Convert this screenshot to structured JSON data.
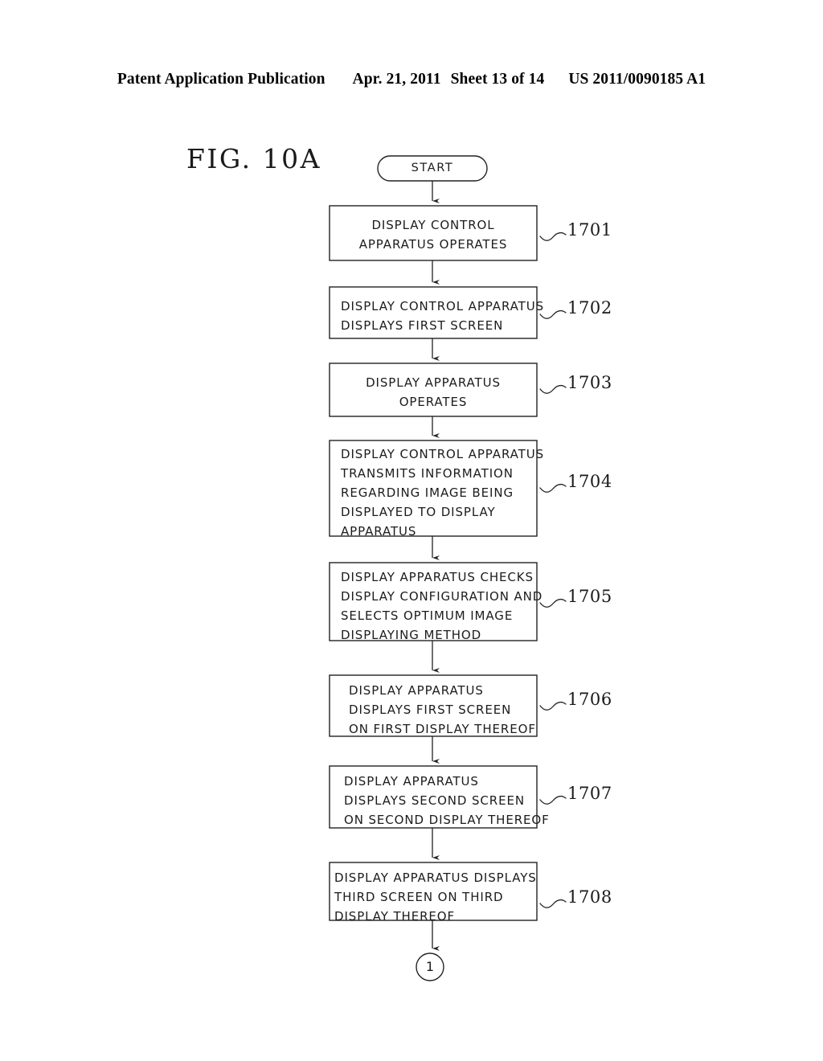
{
  "header": {
    "left": "Patent Application Publication",
    "date": "Apr. 21, 2011",
    "sheet": "Sheet 13 of 14",
    "pubnum": "US 2011/0090185 A1"
  },
  "figure": {
    "title": "FIG. 10A",
    "start_label": "START",
    "end_connector_label": "1"
  },
  "steps": [
    {
      "ref": "1701",
      "align": "center",
      "lines": [
        "DISPLAY CONTROL",
        "APPARATUS OPERATES"
      ],
      "text": "DISPLAY CONTROL\nAPPARATUS OPERATES"
    },
    {
      "ref": "1702",
      "align": "left",
      "lines": [
        "DISPLAY CONTROL APPARATUS",
        "DISPLAYS FIRST SCREEN"
      ],
      "text": "DISPLAY CONTROL APPARATUS\nDISPLAYS FIRST SCREEN"
    },
    {
      "ref": "1703",
      "align": "center",
      "lines": [
        "DISPLAY APPARATUS",
        "OPERATES"
      ],
      "text": "DISPLAY APPARATUS\nOPERATES"
    },
    {
      "ref": "1704",
      "align": "left",
      "lines": [
        "DISPLAY CONTROL APPARATUS",
        "TRANSMITS INFORMATION",
        "REGARDING IMAGE BEING",
        "DISPLAYED TO DISPLAY",
        "APPARATUS"
      ],
      "text": "DISPLAY CONTROL APPARATUS\nTRANSMITS INFORMATION\nREGARDING IMAGE BEING\nDISPLAYED TO DISPLAY\nAPPARATUS"
    },
    {
      "ref": "1705",
      "align": "left",
      "lines": [
        "DISPLAY APPARATUS CHECKS",
        "DISPLAY CONFIGURATION AND",
        "SELECTS OPTIMUM IMAGE",
        "DISPLAYING METHOD"
      ],
      "text": "DISPLAY APPARATUS CHECKS\nDISPLAY CONFIGURATION AND\nSELECTS OPTIMUM IMAGE\nDISPLAYING METHOD"
    },
    {
      "ref": "1706",
      "align": "left",
      "lines": [
        "DISPLAY APPARATUS",
        "DISPLAYS FIRST SCREEN",
        "ON FIRST DISPLAY THEREOF"
      ],
      "text": "DISPLAY APPARATUS\nDISPLAYS FIRST SCREEN\nON FIRST DISPLAY THEREOF"
    },
    {
      "ref": "1707",
      "align": "left",
      "lines": [
        "DISPLAY APPARATUS",
        "DISPLAYS SECOND SCREEN",
        "ON SECOND DISPLAY THEREOF"
      ],
      "text": "DISPLAY APPARATUS\nDISPLAYS SECOND SCREEN\nON SECOND DISPLAY THEREOF"
    },
    {
      "ref": "1708",
      "align": "left",
      "lines": [
        "DISPLAY APPARATUS DISPLAYS",
        "THIRD SCREEN ON THIRD",
        "DISPLAY THEREOF"
      ],
      "text": "DISPLAY APPARATUS DISPLAYS\nTHIRD SCREEN ON THIRD\nDISPLAY THEREOF"
    }
  ],
  "colors": {
    "ink": "#1a1a1a",
    "background": "#ffffff"
  }
}
